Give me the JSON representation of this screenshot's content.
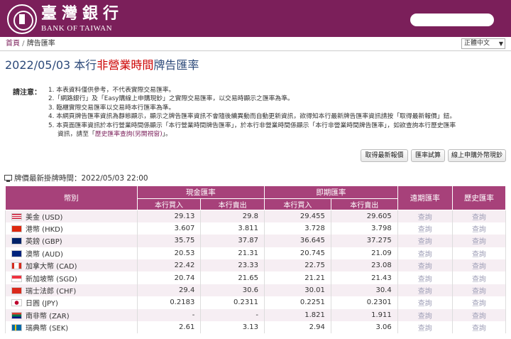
{
  "header": {
    "logo_zh": "臺灣銀行",
    "logo_en": "BANK OF TAIWAN"
  },
  "breadcrumb": {
    "home": "首頁",
    "sep": " / ",
    "current": "牌告匯率"
  },
  "lang_select": {
    "selected": "正體中文"
  },
  "title": {
    "prefix": "2022/05/03 本行",
    "highlight": "非營業時間",
    "suffix": "牌告匯率"
  },
  "notes": {
    "label": "請注意：",
    "items": [
      "1. 本表資料僅供參考，不代表實際交易匯率。",
      "2.「網路銀行」及「Easy購線上申購現鈔」之實際交易匯率，以交易時顯示之匯率為準。",
      "3. 臨櫃實際交易匯率以交易時本行匯率為準。",
      "4. 本網頁牌告匯率資訊為靜態顯示，顯示之牌告匯率資訊不會隨後續異動而自動更新資訊，欲得知本行最新牌告匯率資訊請按「取得最新報價」鈕。",
      "5. 本頁面匯率資訊於本行營業時間係顯示「本行營業時間牌告匯率」，於本行非營業時間係顯示「本行非營業時間牌告匯率」，如欲查詢本行歷史匯率"
    ],
    "item5_cont_prefix": "資訊，請至「",
    "item5_link": "歷史匯率查詢(另開視窗)",
    "item5_cont_suffix": "」。"
  },
  "buttons": {
    "refresh": "取得最新報價",
    "calculator": "匯率試算",
    "cash_order": "線上申購外幣現鈔"
  },
  "quote_time": "牌價最新掛牌時間：2022/05/03 22:00",
  "table": {
    "headers": {
      "currency": "幣別",
      "cash": "現金匯率",
      "spot": "即期匯率",
      "forward": "遠期匯率",
      "history": "歷史匯率",
      "buy": "本行買入",
      "sell": "本行賣出"
    },
    "rows": [
      {
        "currency": "美金 (USD)",
        "flag": "us-flag-icon",
        "cash_buy": "29.13",
        "cash_sell": "29.8",
        "spot_buy": "29.455",
        "spot_sell": "29.605",
        "forward": "查詢",
        "history": "查詢"
      },
      {
        "currency": "港幣 (HKD)",
        "flag": "hk-flag-icon",
        "cash_buy": "3.607",
        "cash_sell": "3.811",
        "spot_buy": "3.728",
        "spot_sell": "3.798",
        "forward": "查詢",
        "history": "查詢"
      },
      {
        "currency": "英鎊 (GBP)",
        "flag": "gb-flag-icon",
        "cash_buy": "35.75",
        "cash_sell": "37.87",
        "spot_buy": "36.645",
        "spot_sell": "37.275",
        "forward": "查詢",
        "history": "查詢"
      },
      {
        "currency": "澳幣 (AUD)",
        "flag": "au-flag-icon",
        "cash_buy": "20.53",
        "cash_sell": "21.31",
        "spot_buy": "20.745",
        "spot_sell": "21.09",
        "forward": "查詢",
        "history": "查詢"
      },
      {
        "currency": "加拿大幣 (CAD)",
        "flag": "ca-flag-icon",
        "cash_buy": "22.42",
        "cash_sell": "23.33",
        "spot_buy": "22.75",
        "spot_sell": "23.08",
        "forward": "查詢",
        "history": "查詢"
      },
      {
        "currency": "新加坡幣 (SGD)",
        "flag": "sg-flag-icon",
        "cash_buy": "20.74",
        "cash_sell": "21.65",
        "spot_buy": "21.21",
        "spot_sell": "21.43",
        "forward": "查詢",
        "history": "查詢"
      },
      {
        "currency": "瑞士法郎 (CHF)",
        "flag": "ch-flag-icon",
        "cash_buy": "29.4",
        "cash_sell": "30.6",
        "spot_buy": "30.01",
        "spot_sell": "30.4",
        "forward": "查詢",
        "history": "查詢"
      },
      {
        "currency": "日圓 (JPY)",
        "flag": "jp-flag-icon",
        "cash_buy": "0.2183",
        "cash_sell": "0.2311",
        "spot_buy": "0.2251",
        "spot_sell": "0.2301",
        "forward": "查詢",
        "history": "查詢"
      },
      {
        "currency": "南非幣 (ZAR)",
        "flag": "za-flag-icon",
        "cash_buy": "-",
        "cash_sell": "-",
        "spot_buy": "1.821",
        "spot_sell": "1.911",
        "forward": "查詢",
        "history": "查詢"
      },
      {
        "currency": "瑞典幣 (SEK)",
        "flag": "se-flag-icon",
        "cash_buy": "2.61",
        "cash_sell": "3.13",
        "spot_buy": "2.94",
        "spot_sell": "3.06",
        "forward": "查詢",
        "history": "查詢"
      }
    ]
  },
  "colors": {
    "brand": "#7b1f5a",
    "table_header": "#a7417a",
    "row_alt": "#f6eef3",
    "title": "#2d4a7a",
    "highlight": "#cc0000",
    "query_link": "#a0a0b8"
  }
}
